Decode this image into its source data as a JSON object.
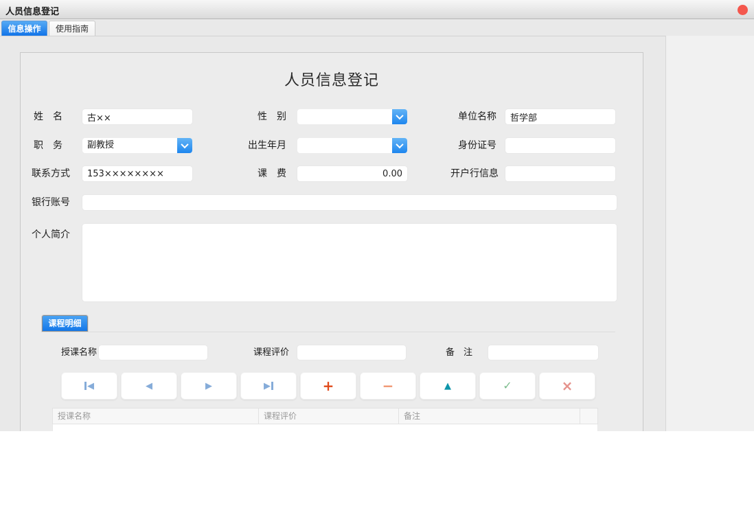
{
  "window": {
    "title": "人员信息登记"
  },
  "titlebar": {
    "close_color": "#f4574d"
  },
  "tabs": {
    "info_ops": "信息操作",
    "user_guide": "使用指南"
  },
  "form": {
    "title": "人员信息登记",
    "name_label": "姓　名",
    "name_value": "古××",
    "gender_label": "性　别",
    "gender_value": "",
    "unit_label": "单位名称",
    "unit_value": "哲学部",
    "position_label": "职　务",
    "position_value": "副教授",
    "birth_label": "出生年月",
    "birth_value": "",
    "idnum_label": "身份证号",
    "idnum_value": "",
    "contact_label": "联系方式",
    "contact_value": "153××××××××",
    "fee_label": "课　费",
    "fee_value": "0.00",
    "bankinfo_label": "开户行信息",
    "bankinfo_value": "",
    "bankacct_label": "银行账号",
    "bankacct_value": "",
    "profile_label": "个人简介",
    "profile_value": ""
  },
  "course": {
    "tab_label": "课程明细",
    "course_name_label": "授课名称",
    "course_name_value": "",
    "course_eval_label": "课程评价",
    "course_eval_value": "",
    "remark_label": "备　注",
    "remark_value": "",
    "navigator": [
      {
        "name": "first-record",
        "glyph": "◀"
      },
      {
        "name": "prior-record",
        "glyph": "◀"
      },
      {
        "name": "next-record",
        "glyph": "▶"
      },
      {
        "name": "last-record",
        "glyph": "▶"
      },
      {
        "name": "insert-record",
        "glyph": "+"
      },
      {
        "name": "delete-record",
        "glyph": "−"
      },
      {
        "name": "edit-record",
        "glyph": "▲"
      },
      {
        "name": "post-edit",
        "glyph": "✓"
      },
      {
        "name": "cancel-edit",
        "glyph": "×"
      }
    ],
    "table_columns": [
      "授课名称",
      "课程评价",
      "备注"
    ]
  },
  "colors": {
    "tab_active_blue": "#1274e8",
    "combo_button_blue": "#1e86ee",
    "close_red": "#f4574d",
    "nav_arrow_blue": "#86acd9",
    "insert_orange_red": "#e04a1a",
    "delete_salmon": "#f0946e",
    "edit_teal": "#0d95aa",
    "post_green": "#7dbd8e",
    "cancel_pink": "#e5928c"
  }
}
